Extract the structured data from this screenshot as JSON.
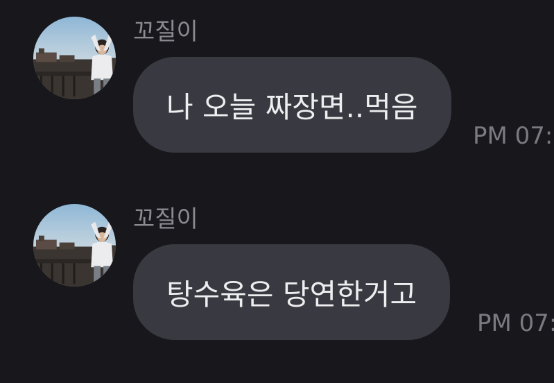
{
  "messages": [
    {
      "sender": "꼬질이",
      "text": "나 오늘 짜장면..먹음",
      "time": "PM 07:",
      "avatar_icon": "profile-photo-heart-pose"
    },
    {
      "sender": "꼬질이",
      "text": "탕수육은 당연한거고",
      "time": "PM 07:",
      "avatar_icon": "profile-photo-heart-pose"
    }
  ],
  "colors": {
    "background": "#17171c",
    "bubble": "#393a41",
    "sender_text": "#8a8a90",
    "message_text": "#eeeef0",
    "time_text": "#7a7a80"
  }
}
